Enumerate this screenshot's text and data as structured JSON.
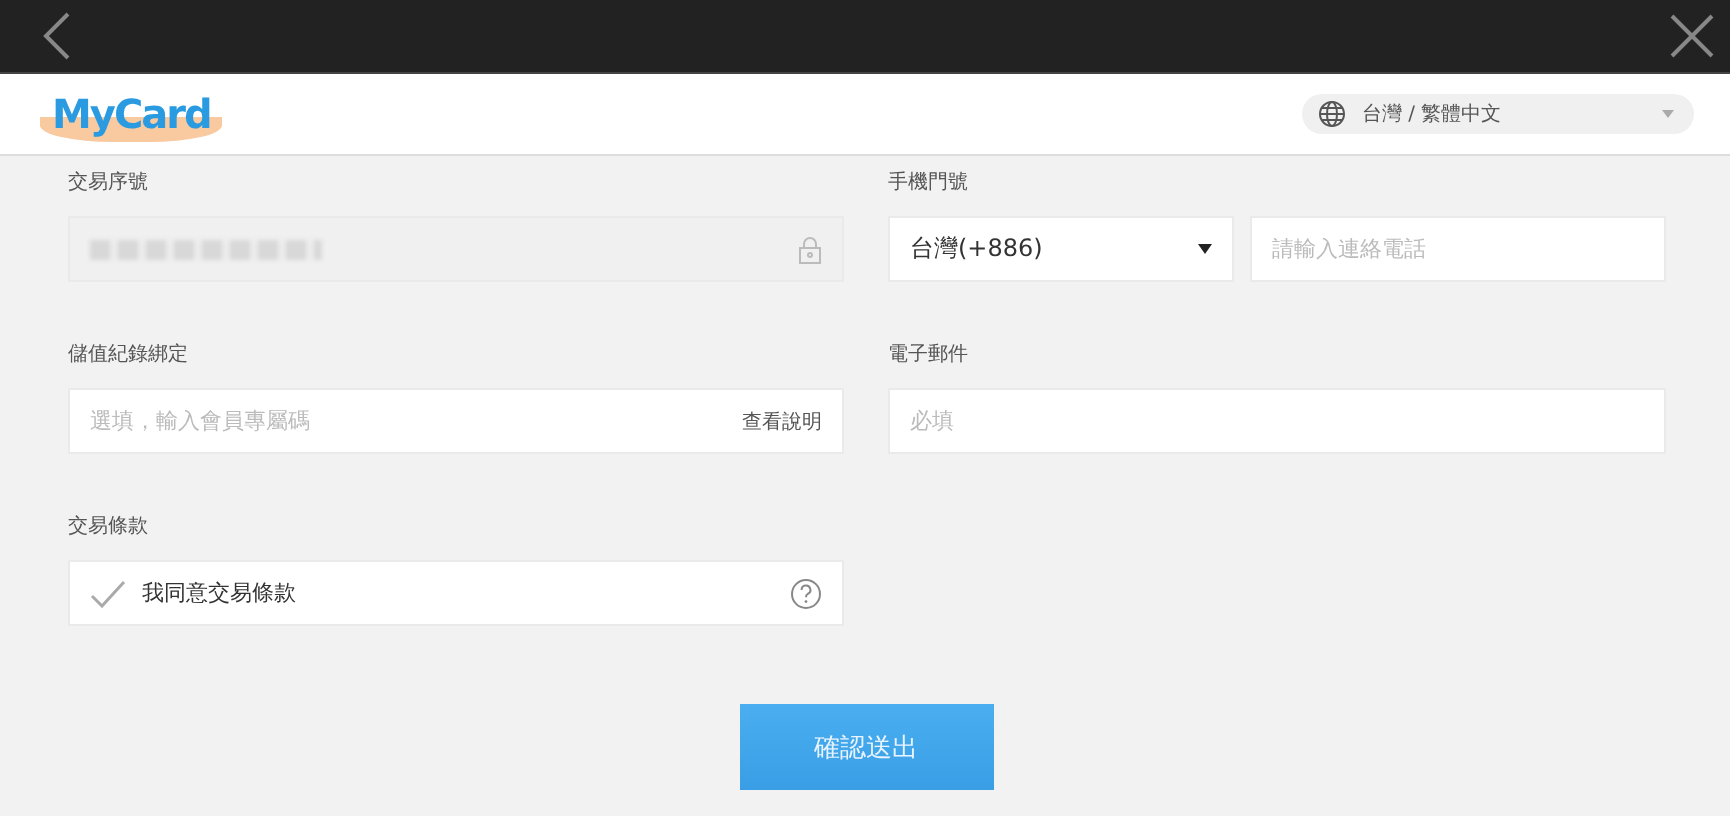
{
  "header": {
    "logo": "MyCard",
    "language": "台灣 / 繁體中文"
  },
  "fields": [
    {
      "kind": "locked",
      "label": "交易序號",
      "redacted": true
    },
    {
      "kind": "phone",
      "label": "手機門號",
      "country": "台灣(+886)",
      "placeholder": "請輸入連絡電話"
    },
    {
      "kind": "text",
      "label": "儲值紀錄綁定",
      "placeholder": "選填，輸入會員專屬碼",
      "link": "查看說明"
    },
    {
      "kind": "text",
      "label": "電子郵件",
      "placeholder": "必填"
    },
    {
      "kind": "agree",
      "label": "交易條款",
      "text": "我同意交易條款",
      "checked": false
    }
  ],
  "submit": "確認送出"
}
